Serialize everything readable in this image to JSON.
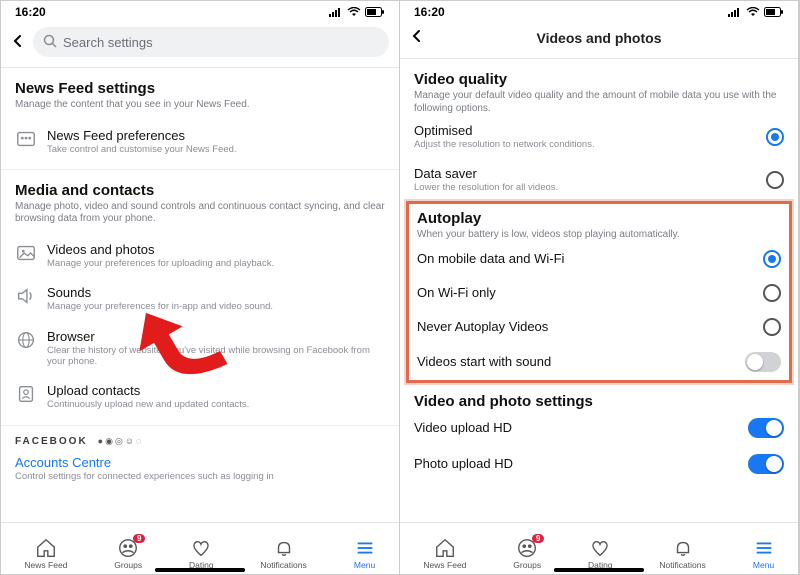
{
  "status": {
    "time": "16:20"
  },
  "left": {
    "search_placeholder": "Search settings",
    "section1": {
      "title": "News Feed settings",
      "sub": "Manage the content that you see in your News Feed.",
      "items": [
        {
          "title": "News Feed preferences",
          "desc": "Take control and customise your News Feed."
        }
      ]
    },
    "section2": {
      "title": "Media and contacts",
      "sub": "Manage photo, video and sound controls and continuous contact syncing, and clear browsing data from your phone.",
      "items": [
        {
          "title": "Videos and photos",
          "desc": "Manage your preferences for uploading and playback."
        },
        {
          "title": "Sounds",
          "desc": "Manage your preferences for in-app and video sound."
        },
        {
          "title": "Browser",
          "desc": "Clear the history of websites you've visited while browsing on Facebook from your phone."
        },
        {
          "title": "Upload contacts",
          "desc": "Continuously upload new and updated contacts."
        }
      ]
    },
    "fb_logo": "FACEBOOK",
    "accounts": {
      "title": "Accounts Centre",
      "desc": "Control settings for connected experiences such as logging in"
    }
  },
  "right": {
    "header_title": "Videos and photos",
    "video_quality": {
      "title": "Video quality",
      "sub": "Manage your default video quality and the amount of mobile data you use with the following options.",
      "options": [
        {
          "title": "Optimised",
          "desc": "Adjust the resolution to network conditions.",
          "selected": true
        },
        {
          "title": "Data saver",
          "desc": "Lower the resolution for all videos.",
          "selected": false
        }
      ]
    },
    "autoplay": {
      "title": "Autoplay",
      "sub": "When your battery is low, videos stop playing automatically.",
      "options": [
        {
          "title": "On mobile data and Wi-Fi",
          "selected": true
        },
        {
          "title": "On Wi-Fi only",
          "selected": false
        },
        {
          "title": "Never Autoplay Videos",
          "selected": false
        }
      ],
      "sound_toggle": {
        "title": "Videos start with sound",
        "on": false
      }
    },
    "vp_settings": {
      "title": "Video and photo settings",
      "toggles": [
        {
          "title": "Video upload HD",
          "on": true
        },
        {
          "title": "Photo upload HD",
          "on": true
        }
      ]
    }
  },
  "tabs": [
    {
      "label": "News Feed",
      "icon": "home",
      "active": false
    },
    {
      "label": "Groups",
      "icon": "groups",
      "active": false,
      "badge": "9"
    },
    {
      "label": "Dating",
      "icon": "heart",
      "active": false
    },
    {
      "label": "Notifications",
      "icon": "bell",
      "active": false
    },
    {
      "label": "Menu",
      "icon": "menu",
      "active": true
    }
  ]
}
